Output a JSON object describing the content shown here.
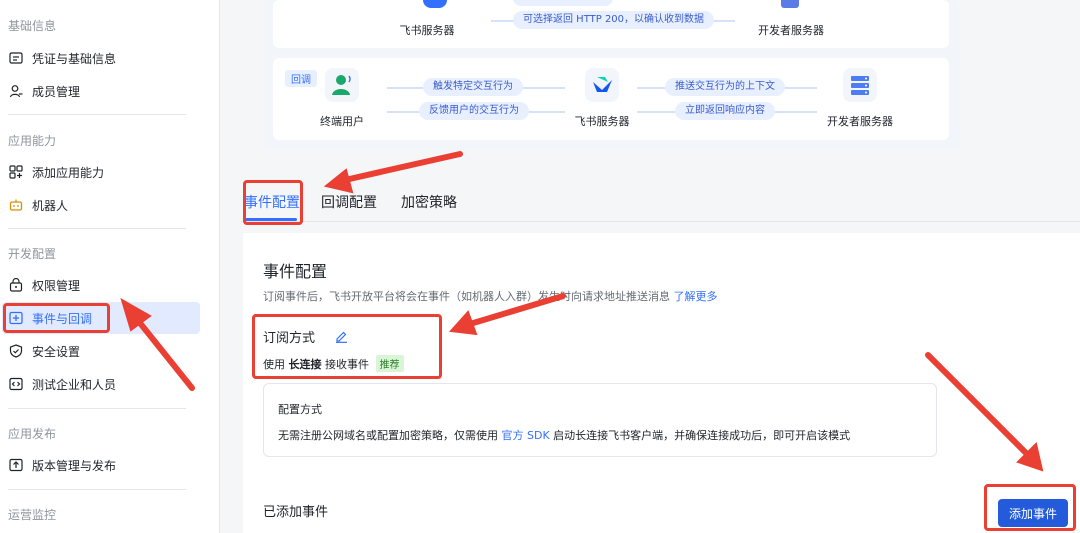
{
  "sidebar": {
    "sections": [
      {
        "title": "基础信息",
        "items": [
          {
            "label": "凭证与基础信息",
            "icon": "credential-icon"
          },
          {
            "label": "成员管理",
            "icon": "member-icon"
          }
        ]
      },
      {
        "title": "应用能力",
        "items": [
          {
            "label": "添加应用能力",
            "icon": "app-ability-icon"
          },
          {
            "label": "机器人",
            "icon": "robot-icon"
          }
        ]
      },
      {
        "title": "开发配置",
        "items": [
          {
            "label": "权限管理",
            "icon": "permission-icon"
          },
          {
            "label": "事件与回调",
            "icon": "event-callback-icon"
          },
          {
            "label": "安全设置",
            "icon": "shield-icon"
          },
          {
            "label": "测试企业和人员",
            "icon": "test-code-icon"
          }
        ]
      },
      {
        "title": "应用发布",
        "items": [
          {
            "label": "版本管理与发布",
            "icon": "upload-icon"
          }
        ]
      },
      {
        "title": "运营监控",
        "items": []
      }
    ],
    "active_item": "事件与回调"
  },
  "flow": {
    "top": {
      "pill_back": "可选择返回 HTTP 200，以确认收到数据",
      "left_node": "飞书服务器",
      "right_node": "开发者服务器"
    },
    "callback": {
      "tag": "回调",
      "node1": "终端用户",
      "node2": "飞书服务器",
      "node3": "开发者服务器",
      "pill_1": "触发特定交互行为",
      "pill_2": "反馈用户的交互行为",
      "pill_3": "推送交互行为的上下文",
      "pill_4": "立即返回响应内容"
    }
  },
  "tabs": [
    "事件配置",
    "回调配置",
    "加密策略"
  ],
  "active_tab": "事件配置",
  "panel": {
    "title": "事件配置",
    "desc": "订阅事件后，飞书开放平台将会在事件（如机器人入群）发生时向请求地址推送消息",
    "desc_link": "了解更多",
    "sub_title": "订阅方式",
    "use_prefix": "使用",
    "use_bold": "长连接",
    "use_suffix": "接收事件",
    "badge": "推荐",
    "config_title": "配置方式",
    "config_desc_prefix": "无需注册公网域名或配置加密策略，仅需使用",
    "config_link": "官方 SDK",
    "config_desc_suffix": "启动长连接飞书客户端，并确保连接成功后，即可开启该模式",
    "added_title": "已添加事件",
    "add_button": "添加事件"
  },
  "colors": {
    "accent": "#3370ff",
    "primary_button": "#245bdb",
    "annotation_red": "#ea3f33",
    "active_bg": "#e1eaff"
  }
}
